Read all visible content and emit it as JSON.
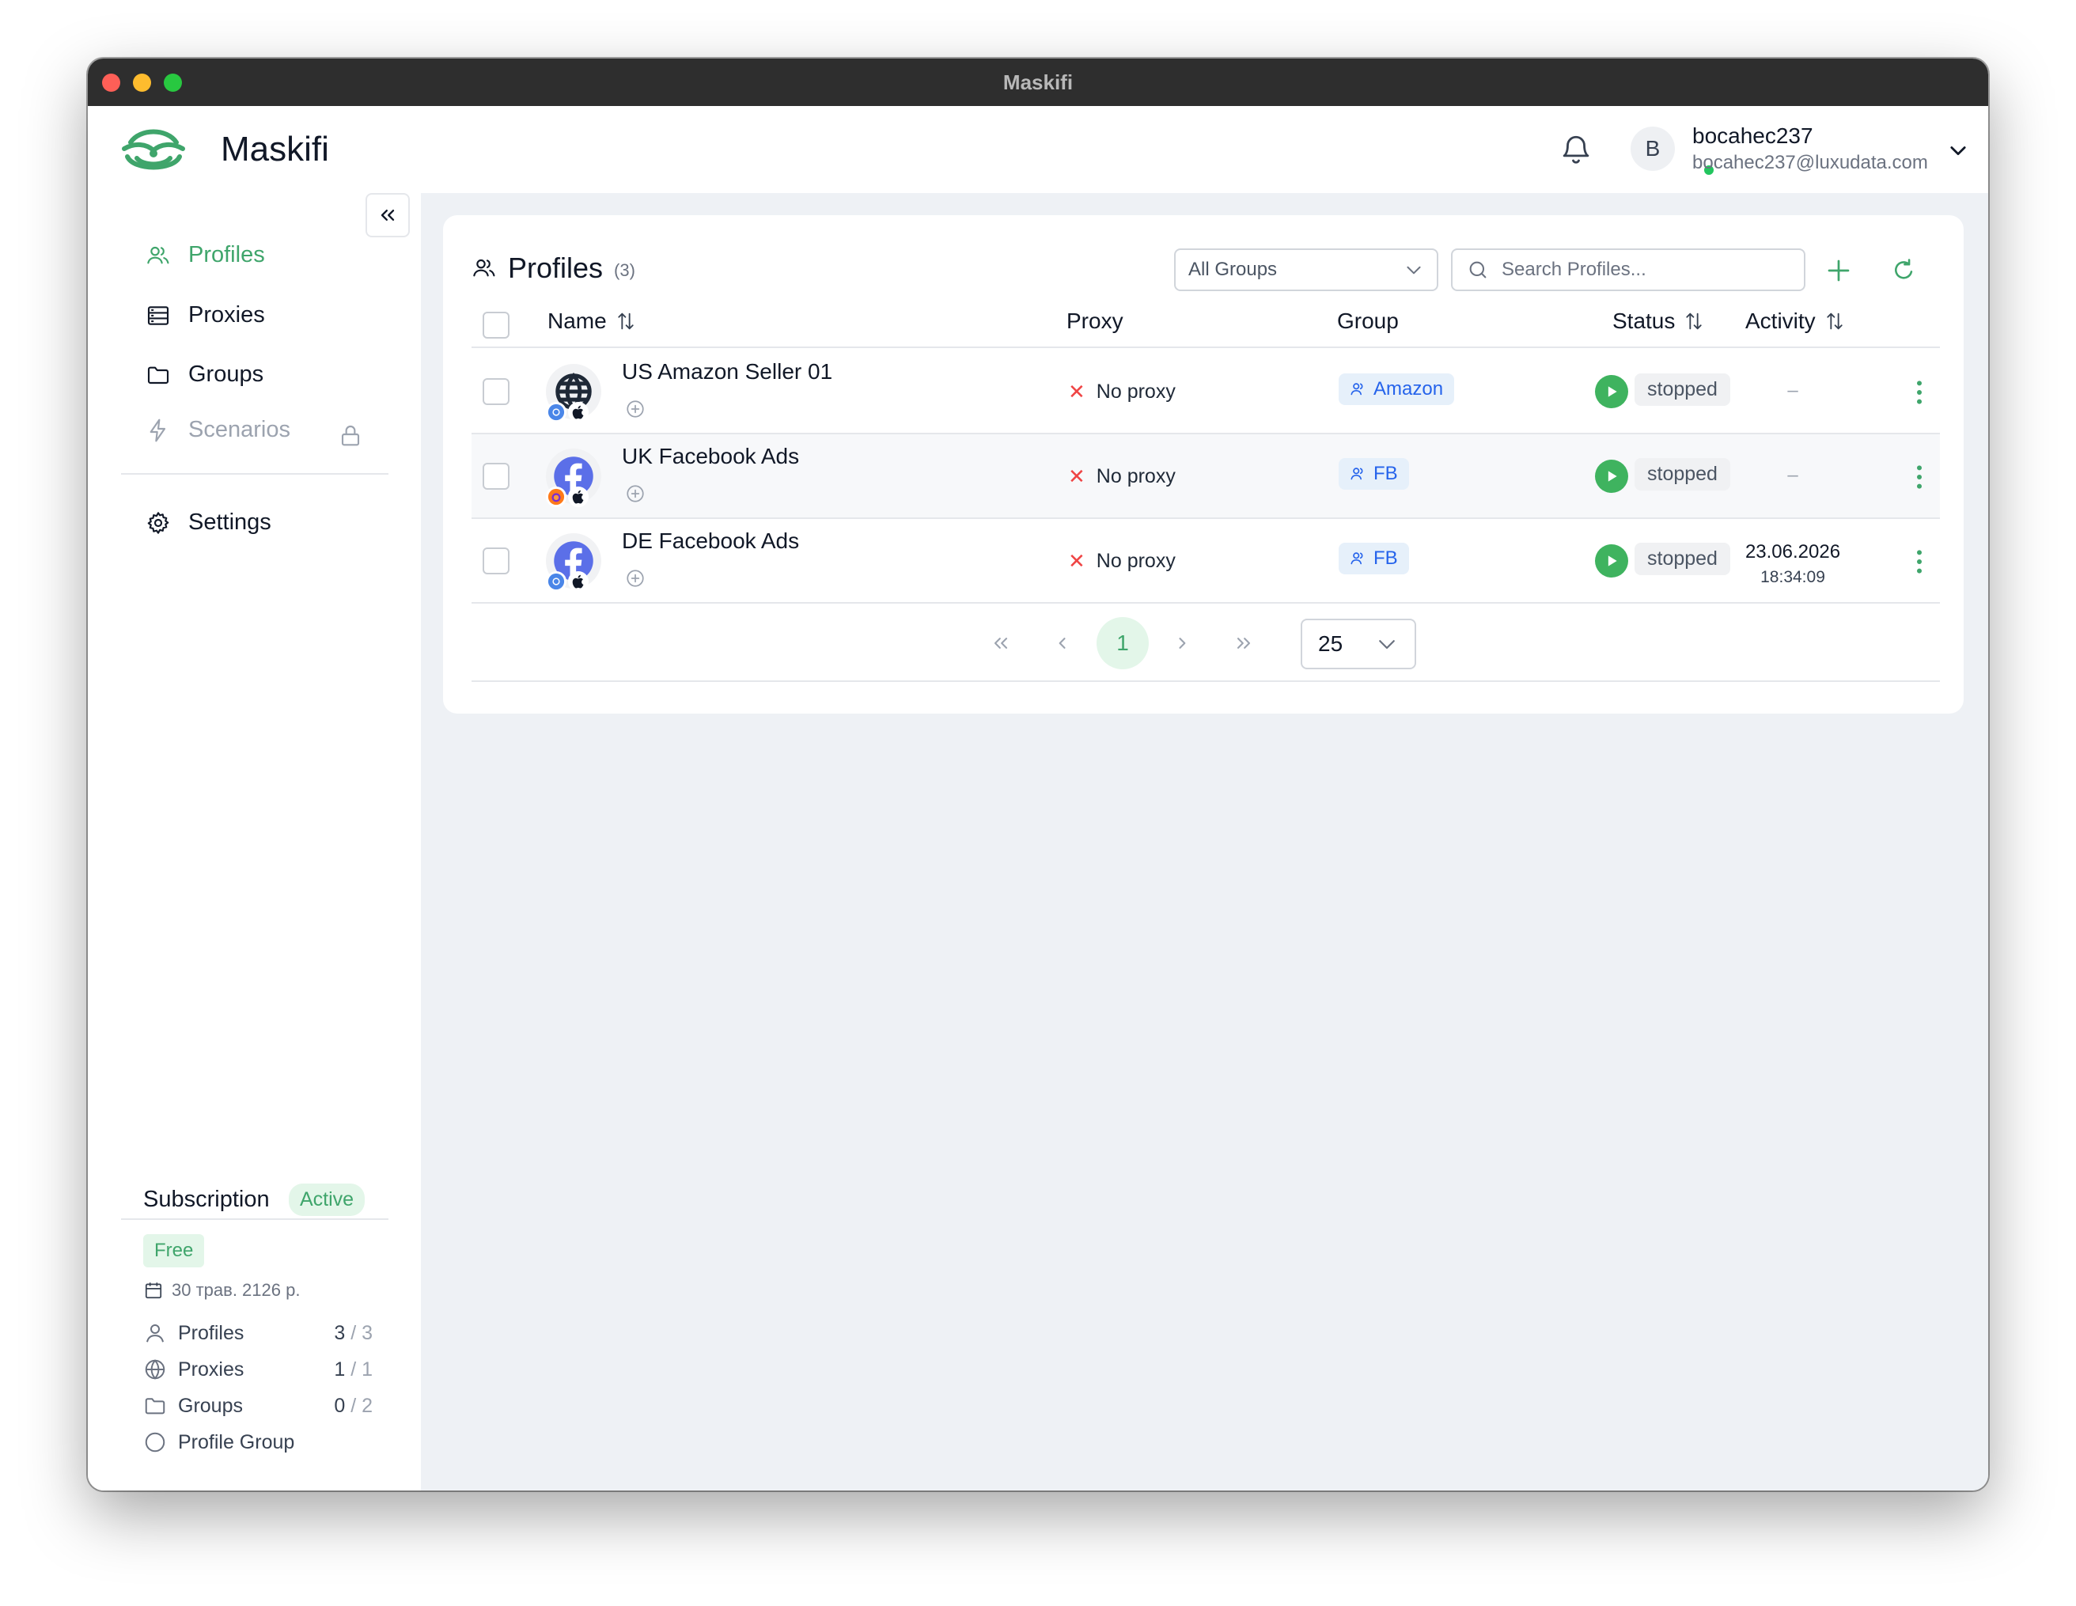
{
  "window": {
    "title": "Maskifi"
  },
  "header": {
    "app_name": "Maskifi",
    "user": {
      "avatar_letter": "B",
      "name": "bocahec237",
      "email": "bocahec237@luxudata.com",
      "online": true
    }
  },
  "sidebar": {
    "items": [
      {
        "label": "Profiles",
        "icon": "users-icon",
        "active": true
      },
      {
        "label": "Proxies",
        "icon": "server-icon"
      },
      {
        "label": "Groups",
        "icon": "folder-icon"
      },
      {
        "label": "Scenarios",
        "icon": "bolt-icon",
        "locked": true
      },
      {
        "label": "Settings",
        "icon": "gear-icon"
      }
    ],
    "subscription": {
      "title": "Subscription",
      "status": "Active",
      "plan": "Free",
      "expires": "30 трав. 2126 р.",
      "limits": [
        {
          "label": "Profiles",
          "used": "3",
          "total": "3"
        },
        {
          "label": "Proxies",
          "used": "1",
          "total": "1"
        },
        {
          "label": "Groups",
          "used": "0",
          "total": "2"
        },
        {
          "label": "Profile Group"
        }
      ]
    }
  },
  "profiles": {
    "title": "Profiles",
    "count": "(3)",
    "group_filter": "All Groups",
    "search_placeholder": "Search Profiles...",
    "columns": {
      "name": "Name",
      "proxy": "Proxy",
      "group": "Group",
      "status": "Status",
      "activity": "Activity"
    },
    "rows": [
      {
        "name": "US Amazon Seller 01",
        "icon": "globe-icon",
        "browser": "chrome-icon",
        "os": "apple-icon",
        "proxy": "No proxy",
        "group": "Amazon",
        "status": "stopped",
        "activity_date": "",
        "activity_time": "",
        "activity_empty": "–"
      },
      {
        "name": "UK Facebook Ads",
        "icon": "facebook-icon",
        "browser": "firefox-icon",
        "os": "apple-icon",
        "proxy": "No proxy",
        "group": "FB",
        "status": "stopped",
        "activity_date": "",
        "activity_time": "",
        "activity_empty": "–"
      },
      {
        "name": "DE Facebook Ads",
        "icon": "facebook-icon",
        "browser": "chrome-icon",
        "os": "apple-icon",
        "proxy": "No proxy",
        "group": "FB",
        "status": "stopped",
        "activity_date": "23.06.2026",
        "activity_time": "18:34:09",
        "activity_empty": ""
      }
    ],
    "pagination": {
      "current_page": "1",
      "per_page": "25"
    }
  },
  "colors": {
    "accent": "#3fa56b",
    "play": "#3fb35f",
    "tag_text": "#2563eb",
    "error": "#ef4444"
  }
}
